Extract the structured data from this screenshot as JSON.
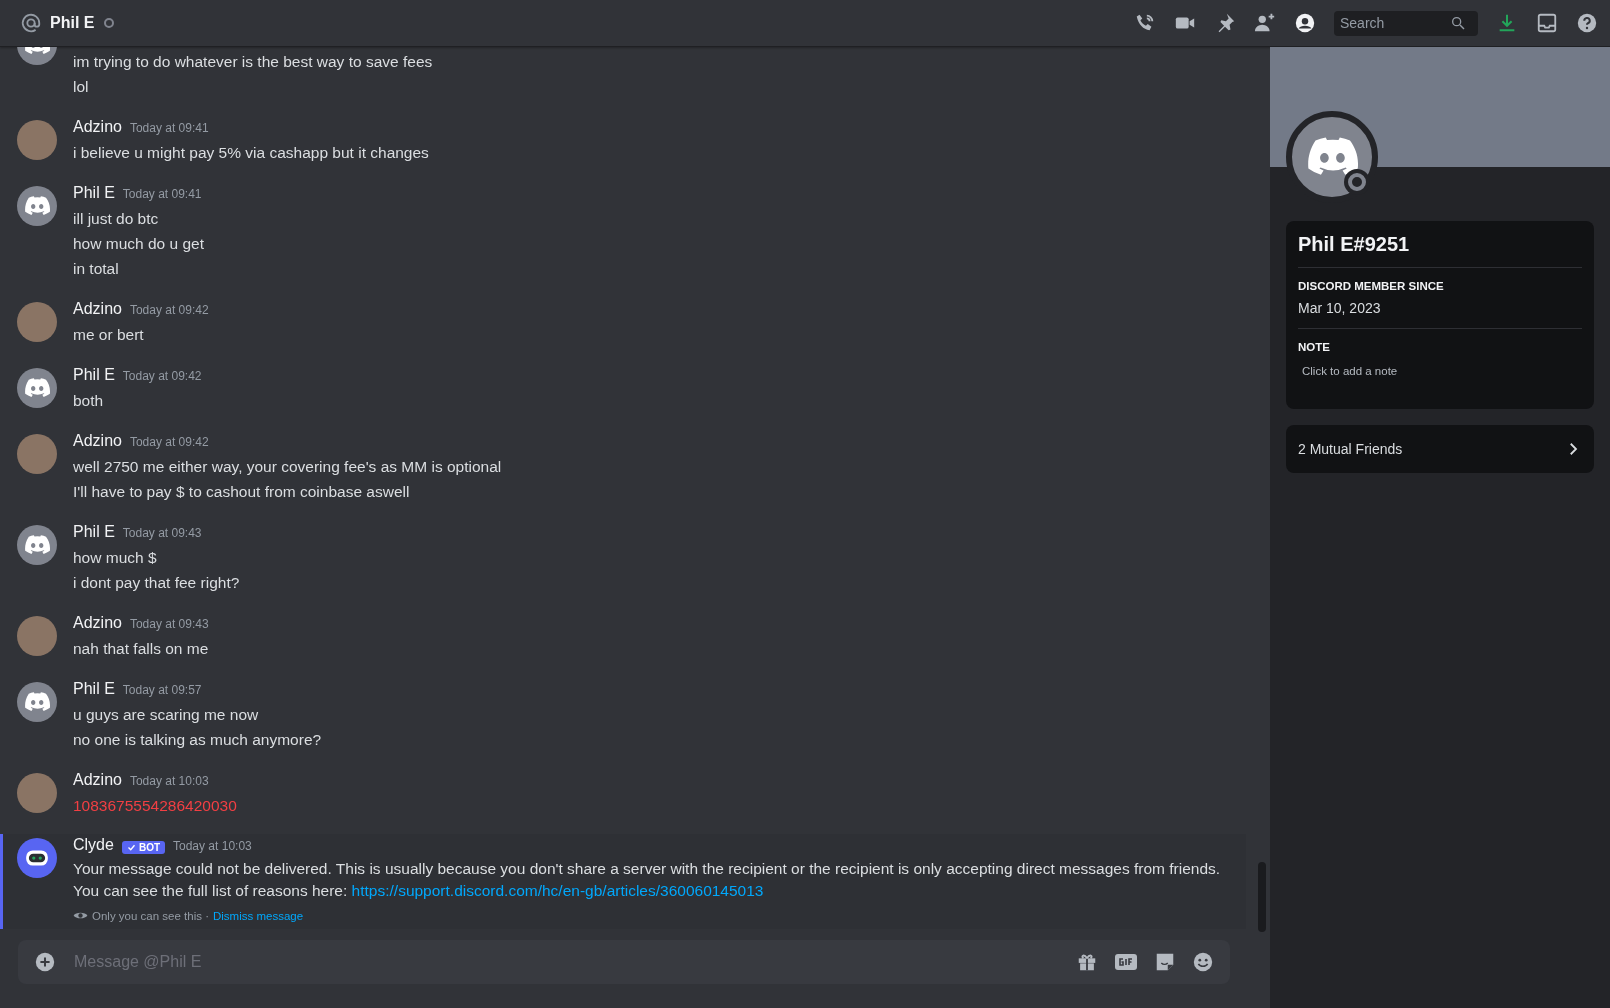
{
  "header": {
    "channel_name": "Phil E",
    "search": {
      "placeholder": "Search"
    }
  },
  "messages": [
    {
      "kind": "discord",
      "lines": [
        {
          "text": "im trying to do whatever is the best way to save fees"
        },
        {
          "text": "lol"
        }
      ]
    },
    {
      "author": "Adzino",
      "kind": "photo",
      "time": "Today at 09:41",
      "lines": [
        {
          "text": "i believe u might pay 5% via cashapp but it changes"
        }
      ]
    },
    {
      "author": "Phil E",
      "kind": "discord",
      "time": "Today at 09:41",
      "lines": [
        {
          "text": "ill just do btc"
        },
        {
          "text": "how much do u get"
        },
        {
          "text": "in total"
        }
      ]
    },
    {
      "author": "Adzino",
      "kind": "photo",
      "time": "Today at 09:42",
      "lines": [
        {
          "text": "me or bert"
        }
      ]
    },
    {
      "author": "Phil E",
      "kind": "discord",
      "time": "Today at 09:42",
      "lines": [
        {
          "text": "both"
        }
      ]
    },
    {
      "author": "Adzino",
      "kind": "photo",
      "time": "Today at 09:42",
      "lines": [
        {
          "text": "well 2750 me either way, your covering fee's as MM is optional"
        },
        {
          "text": "I'll have to pay $ to cashout from coinbase aswell"
        }
      ]
    },
    {
      "author": "Phil E",
      "kind": "discord",
      "time": "Today at 09:43",
      "lines": [
        {
          "text": "how much $"
        },
        {
          "text": "i dont pay that fee right?"
        }
      ]
    },
    {
      "author": "Adzino",
      "kind": "photo",
      "time": "Today at 09:43",
      "lines": [
        {
          "text": "nah that falls on me"
        }
      ]
    },
    {
      "author": "Phil E",
      "kind": "discord",
      "time": "Today at 09:57",
      "lines": [
        {
          "text": "u guys are scaring me now"
        },
        {
          "text": "no one is talking as much anymore?"
        }
      ]
    },
    {
      "author": "Adzino",
      "kind": "photo",
      "time": "Today at 10:03",
      "lines": [
        {
          "text": "1083675554286420030",
          "failed": true
        }
      ]
    },
    {
      "author": "Clyde",
      "kind": "bot",
      "badge": "BOT",
      "time": "Today at 10:03",
      "ephemeral": true,
      "lines": [
        {
          "text": "Your message could not be delivered. This is usually because you don't share a server with the recipient or the recipient is only accepting direct messages from friends."
        },
        {
          "text": "You can see the full list of reasons here: ",
          "link": "https://support.discord.com/hc/en-gb/articles/360060145013"
        }
      ],
      "notice": {
        "text": "Only you can see this · ",
        "action": "Dismiss message"
      }
    }
  ],
  "composer": {
    "placeholder": "Message @Phil E"
  },
  "profile": {
    "username": "Phil E#9251",
    "sections": [
      {
        "heading": "DISCORD MEMBER SINCE",
        "value": "Mar 10, 2023",
        "kind": "text"
      },
      {
        "heading": "NOTE",
        "value": "Click to add a note",
        "kind": "note"
      }
    ],
    "mutual_friends": "2 Mutual Friends"
  }
}
